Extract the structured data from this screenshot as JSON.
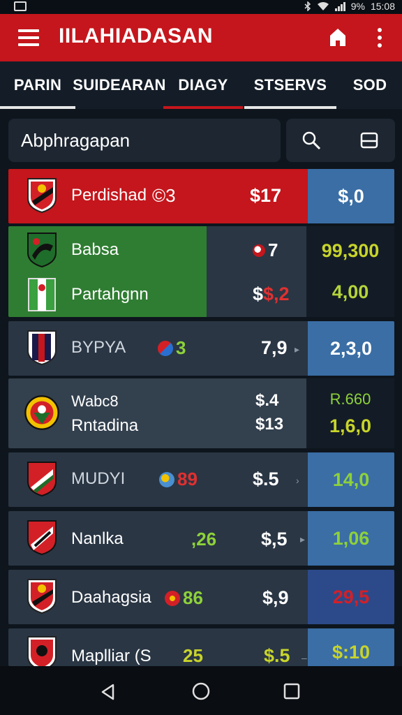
{
  "status_bar": {
    "time": "15:08",
    "battery": "9%",
    "icons": [
      "photo-icon",
      "bluetooth-icon",
      "wifi-icon",
      "signal-icon"
    ]
  },
  "app_bar": {
    "title": "IILAHIADASAN",
    "icons": [
      "menu-icon",
      "home-icon",
      "more-icon"
    ],
    "color": "#c4161c"
  },
  "tabs": [
    {
      "label": "PARIN",
      "active": false
    },
    {
      "label": "SUIDEARAN",
      "active": false
    },
    {
      "label": "DIAGY",
      "active": true
    },
    {
      "label": "STSERVS",
      "active": false
    },
    {
      "label": "SOD",
      "active": false
    }
  ],
  "search": {
    "placeholder": "Abphragapan",
    "icons": [
      "search-icon",
      "filter-icon"
    ]
  },
  "colors": {
    "red": "#c4161c",
    "green": "#2f7d32",
    "blue": "#3a6ea5",
    "dark_row": "#2a3644",
    "yellow_green": "#b5d43a"
  },
  "rows": [
    {
      "team": "Perdishad",
      "badge": "©3",
      "price": "$17",
      "odds": "$,0"
    },
    {
      "team_a": "Babsa",
      "team_b": "Partahgnn",
      "badge": "7",
      "price_b": "$,2",
      "odds_a": "99,300",
      "odds_b": "4,00"
    },
    {
      "team": "BYPYA",
      "badge": "3",
      "price": "7,9",
      "odds": "2,3,0"
    },
    {
      "team_a": "Wabc8",
      "team_b": "Rntadina",
      "price_a": "$.4",
      "price_b": "$13",
      "odds_a": "R.660",
      "odds_b": "1,6,0"
    },
    {
      "team": "MUDYI",
      "badge": "89",
      "price": "$.5",
      "odds": "14,0"
    },
    {
      "team": "Nanlka",
      "badge": ",26",
      "price": "$,5",
      "odds": "1,06"
    },
    {
      "team": "Daahagsia",
      "badge": "86",
      "price": "$,9",
      "odds": "29,5"
    },
    {
      "team": "Maplliar (S",
      "badge": "25",
      "price": "$.5",
      "odds": "$:10"
    }
  ],
  "nav_bar": {
    "icons": [
      "back-icon",
      "home-circle-icon",
      "recents-icon"
    ]
  }
}
